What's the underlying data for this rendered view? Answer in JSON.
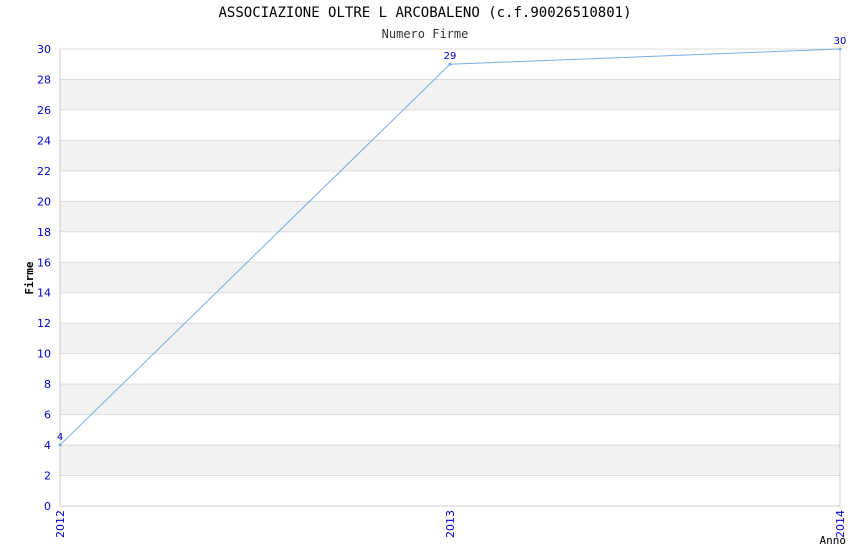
{
  "chart_data": {
    "type": "line",
    "title": "ASSOCIAZIONE OLTRE L ARCOBALENO (c.f.90026510801)",
    "subtitle": "Numero Firme",
    "xlabel": "Anno",
    "ylabel": "Firme",
    "x": [
      "2012",
      "2013",
      "2014"
    ],
    "values": [
      4,
      29,
      30
    ],
    "ylim": [
      0,
      30
    ],
    "yticks": [
      0,
      2,
      4,
      6,
      8,
      10,
      12,
      14,
      16,
      18,
      20,
      22,
      24,
      26,
      28,
      30
    ],
    "grid": true,
    "colors": {
      "line": "#7aaee8",
      "tick": "#0000cc",
      "band": "#f2f2f2",
      "gridline": "#dddddd"
    }
  }
}
